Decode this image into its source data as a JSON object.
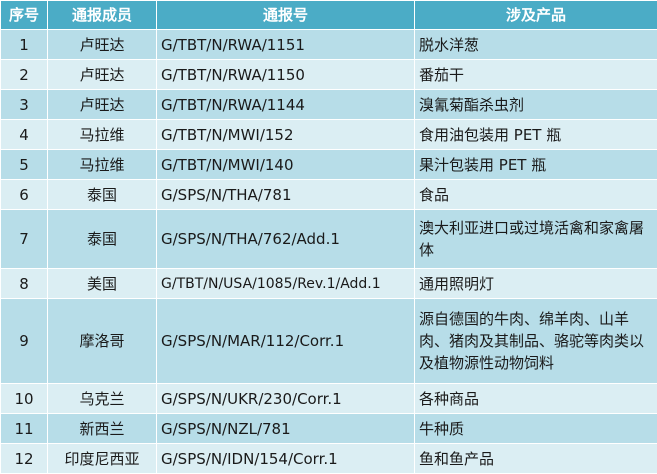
{
  "table": {
    "headers": {
      "no": "序号",
      "member": "通报成员",
      "code": "通报号",
      "product": "涉及产品"
    },
    "rows": [
      {
        "no": "1",
        "member": "卢旺达",
        "code": "G/TBT/N/RWA/1151",
        "product": "脱水洋葱"
      },
      {
        "no": "2",
        "member": "卢旺达",
        "code": "G/TBT/N/RWA/1150",
        "product": "番茄干"
      },
      {
        "no": "3",
        "member": "卢旺达",
        "code": "G/TBT/N/RWA/1144",
        "product": "溴氰菊酯杀虫剂"
      },
      {
        "no": "4",
        "member": "马拉维",
        "code": "G/TBT/N/MWI/152",
        "product": "食用油包装用 PET 瓶"
      },
      {
        "no": "5",
        "member": "马拉维",
        "code": "G/TBT/N/MWI/140",
        "product": "果汁包装用 PET 瓶"
      },
      {
        "no": "6",
        "member": "泰国",
        "code": "G/SPS/N/THA/781",
        "product": "食品"
      },
      {
        "no": "7",
        "member": "泰国",
        "code": "G/SPS/N/THA/762/Add.1",
        "product": "澳大利亚进口或过境活禽和家禽屠体"
      },
      {
        "no": "8",
        "member": "美国",
        "code": "G/TBT/N/USA/1085/Rev.1/Add.1",
        "product": "通用照明灯"
      },
      {
        "no": "9",
        "member": "摩洛哥",
        "code": "G/SPS/N/MAR/112/Corr.1",
        "product": "源自德国的牛肉、绵羊肉、山羊肉、猪肉及其制品、骆驼等肉类以及植物源性动物饲料"
      },
      {
        "no": "10",
        "member": "乌克兰",
        "code": "G/SPS/N/UKR/230/Corr.1",
        "product": "各种商品"
      },
      {
        "no": "11",
        "member": "新西兰",
        "code": "G/SPS/N/NZL/781",
        "product": "牛种质"
      },
      {
        "no": "12",
        "member": "印度尼西亚",
        "code": "G/SPS/N/IDN/154/Corr.1",
        "product": "鱼和鱼产品"
      }
    ]
  },
  "colors": {
    "header_bg": "#4bacc6",
    "band_dark": "#b7dde8",
    "band_light": "#dbeef3"
  }
}
